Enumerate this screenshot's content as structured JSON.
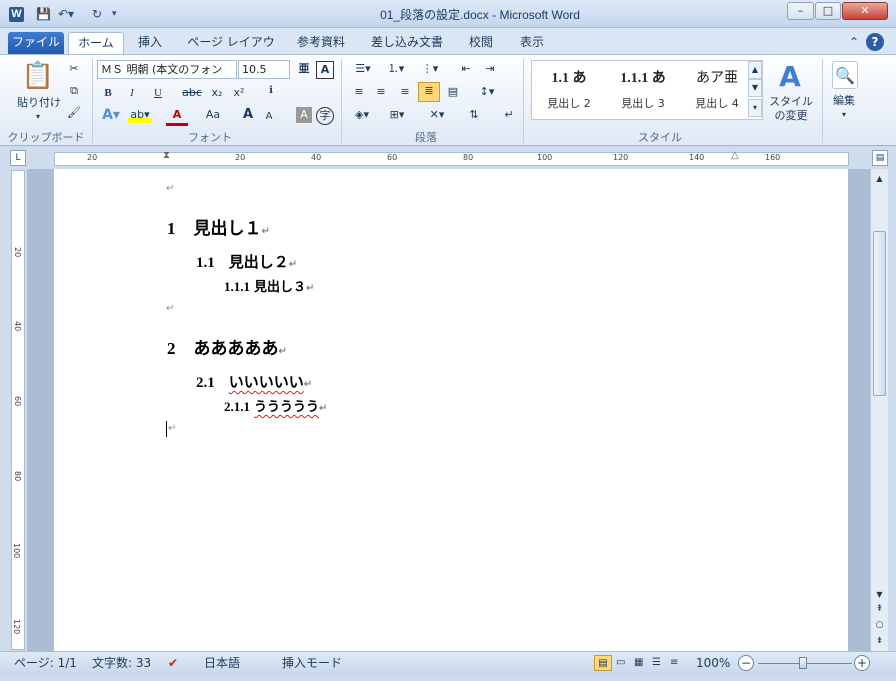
{
  "window": {
    "title": "01_段落の設定.docx - Microsoft Word",
    "app_icon": "W"
  },
  "tabs": [
    {
      "label": "ファイル"
    },
    {
      "label": "ホーム"
    },
    {
      "label": "挿入"
    },
    {
      "label": "ページ レイアウト"
    },
    {
      "label": "参考資料"
    },
    {
      "label": "差し込み文書"
    },
    {
      "label": "校閲"
    },
    {
      "label": "表示"
    }
  ],
  "clipboard": {
    "paste_label": "貼り付け",
    "group_label": "クリップボード"
  },
  "font": {
    "name": "ＭＳ 明朝 (本文のフォン",
    "size": "10.5",
    "group_label": "フォント",
    "bold": "B",
    "italic": "I",
    "underline": "U",
    "strike": "abc",
    "sub": "x₂",
    "sup": "x²",
    "case": "Aa",
    "grow": "A",
    "shrink": "A",
    "char_shade": "A",
    "enclose": "字",
    "ruby": "亜",
    "clear": "A"
  },
  "paragraph": {
    "group_label": "段落"
  },
  "styles": {
    "group_label": "スタイル",
    "items": [
      {
        "preview": "1.1  あ",
        "name": "見出し 2"
      },
      {
        "preview": "1.1.1  あ",
        "name": "見出し 3"
      },
      {
        "preview": "あア亜",
        "name": "見出し 4"
      }
    ],
    "change_label": "スタイルの変更"
  },
  "editing": {
    "label": "編集"
  },
  "ruler_ticks": [
    "20",
    "20",
    "40",
    "60",
    "80",
    "100",
    "120",
    "140",
    "160"
  ],
  "vruler_ticks": [
    "20",
    "40",
    "60",
    "80",
    "100",
    "120"
  ],
  "document": {
    "h1a": {
      "num": "1",
      "text": "見出し１"
    },
    "h2a": {
      "num": "1.1",
      "text": "見出し２"
    },
    "h3a": {
      "num": "1.1.1",
      "text": "見出し３"
    },
    "h1b": {
      "num": "2",
      "text": "あああああ"
    },
    "h2b": {
      "num": "2.1",
      "text": "いいいいい"
    },
    "h3b": {
      "num": "2.1.1",
      "text": "ううううう"
    },
    "para_mark": "↵"
  },
  "status": {
    "page": "ページ: 1/1",
    "words": "文字数: 33",
    "language": "日本語",
    "mode": "挿入モード",
    "zoom": "100%"
  }
}
